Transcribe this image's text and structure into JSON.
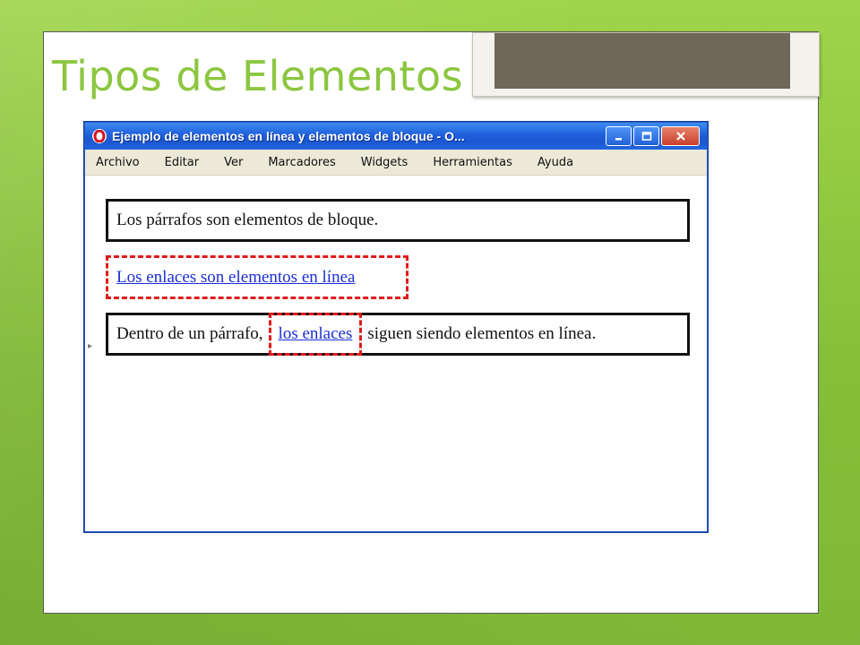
{
  "slide": {
    "title": "Tipos de Elementos",
    "accent_color": "#8cc63f"
  },
  "browser": {
    "icon": "opera-logo-icon",
    "window_title": "Ejemplo de elementos en línea y elementos de bloque - O...",
    "controls": {
      "minimize": "minimize-icon",
      "maximize": "maximize-icon",
      "close": "close-icon"
    },
    "menu": [
      "Archivo",
      "Editar",
      "Ver",
      "Marcadores",
      "Widgets",
      "Herramientas",
      "Ayuda"
    ]
  },
  "content": {
    "paragraph1": "Los párrafos son elementos de bloque.",
    "link_standalone": "Los enlaces son elementos en línea",
    "paragraph3": {
      "before": "Dentro de un párrafo, ",
      "link": "los enlaces",
      "after": " siguen siendo elementos en línea."
    }
  },
  "colors": {
    "block_border": "#111111",
    "inline_border": "#e01a1a",
    "link": "#1a2fd6"
  }
}
